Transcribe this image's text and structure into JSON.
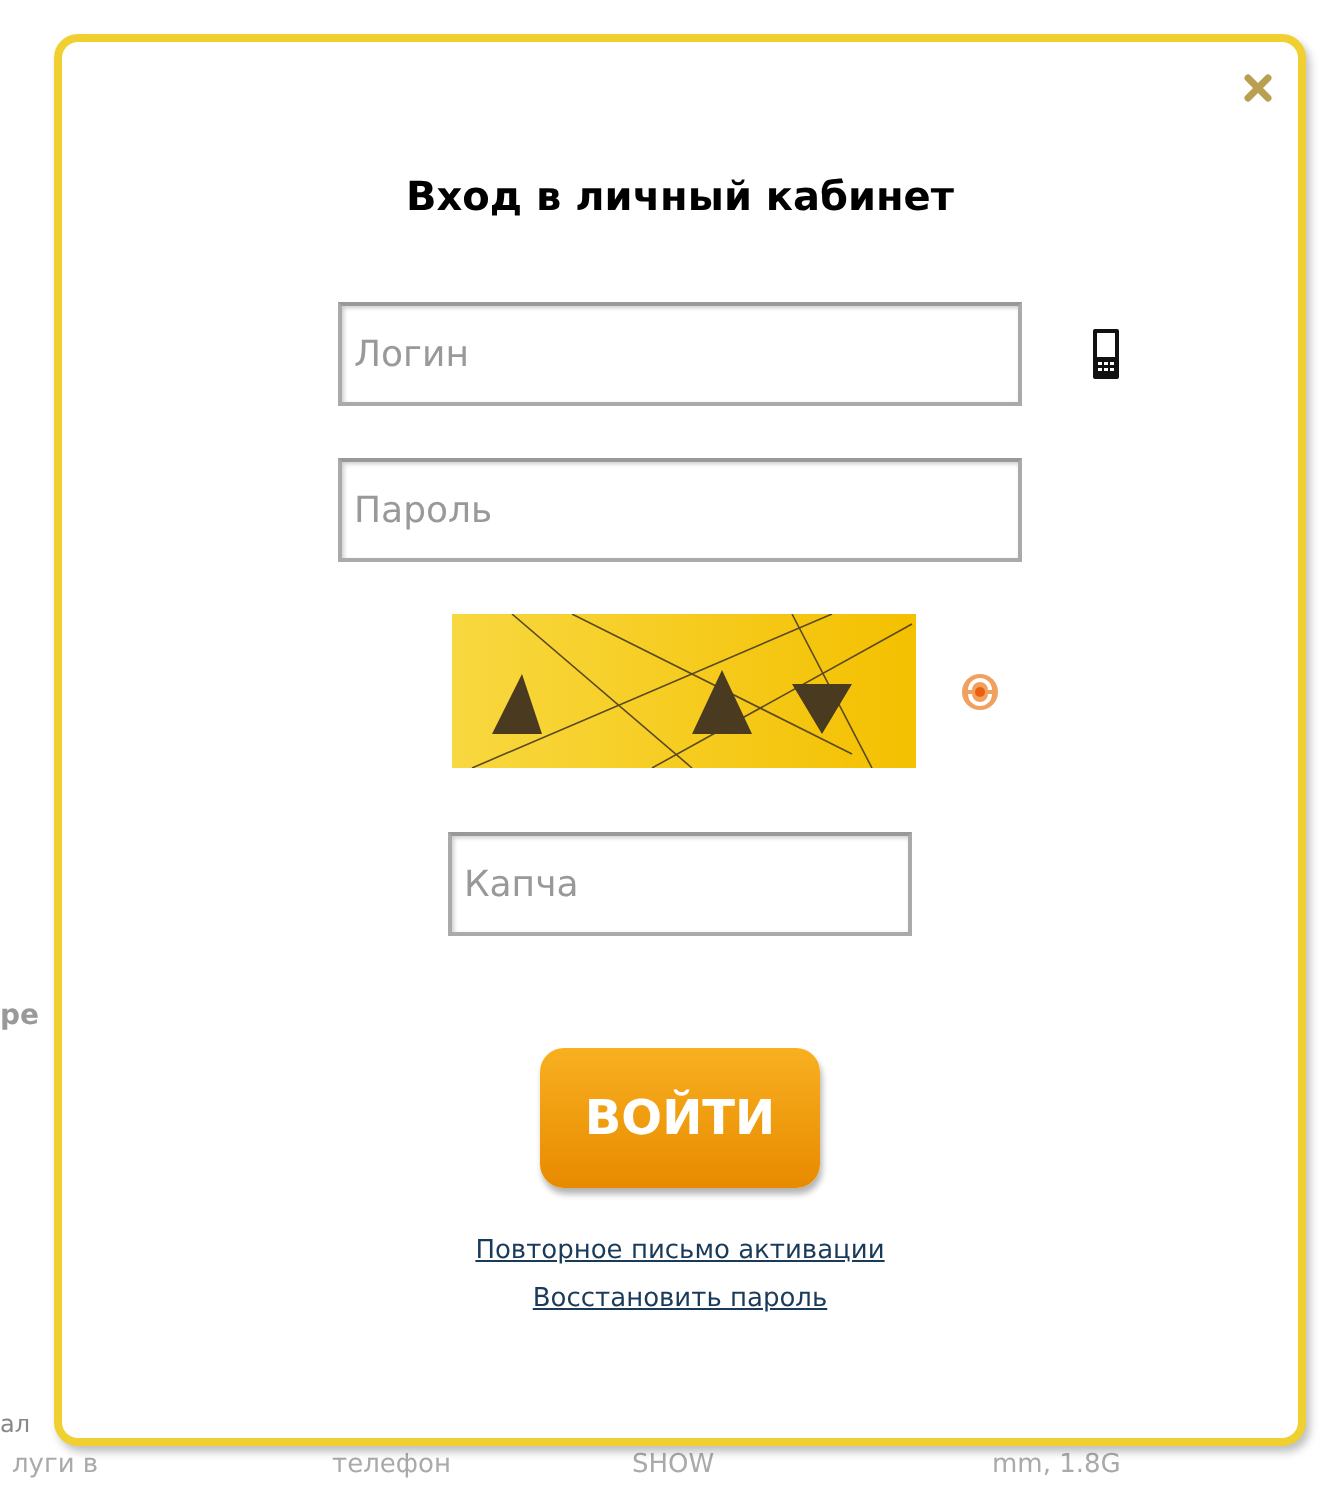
{
  "background": {
    "side_texts": [
      "ре",
      "ал"
    ],
    "bottom_row": [
      "луги в",
      "телефон",
      "SHOW",
      "mm, 1.8G"
    ]
  },
  "dialog": {
    "title": "Вход в личный кабинет",
    "fields": [
      {
        "kind": "login",
        "placeholder": "Логин"
      },
      {
        "kind": "password",
        "placeholder": "Пароль"
      }
    ],
    "captcha": {
      "placeholder": "Капча"
    },
    "button": "ВОЙТИ",
    "links": [
      "Повторное письмо активации",
      "Восстановить пароль"
    ]
  }
}
